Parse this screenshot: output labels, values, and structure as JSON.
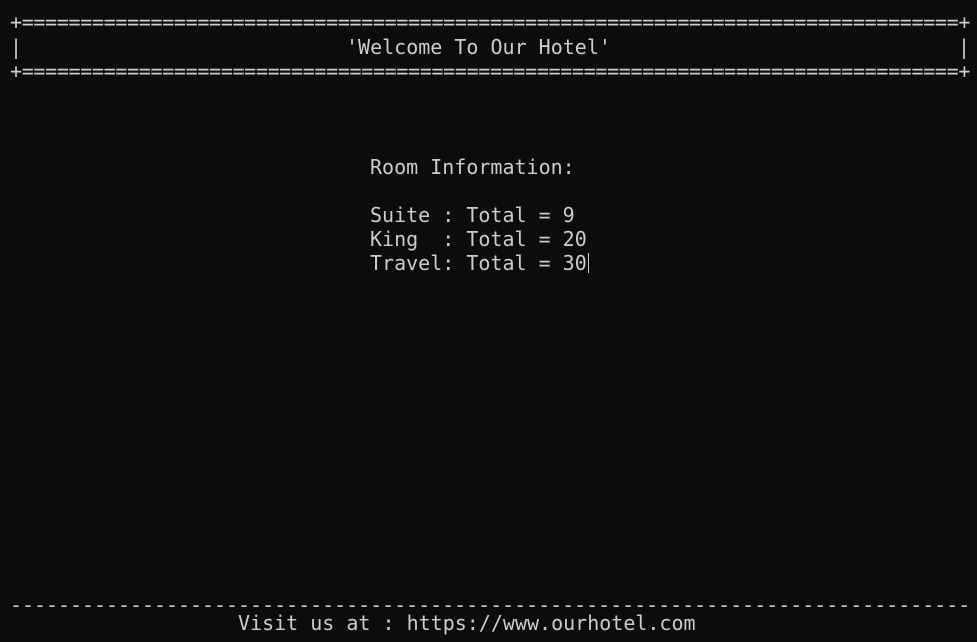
{
  "header": {
    "top_rule": "+================================================================================+",
    "left_border": "|",
    "title": "'Welcome To Our Hotel'",
    "right_border": "|",
    "bottom_rule": "+================================================================================+"
  },
  "room_info": {
    "heading": "Room Information:",
    "rows": [
      "Suite : Total = 9",
      "King  : Total = 20",
      "Travel: Total = 30"
    ]
  },
  "footer": {
    "rule": "--------------------------------------------------------------------------------",
    "text": "Visit us at : https://www.ourhotel.com"
  }
}
